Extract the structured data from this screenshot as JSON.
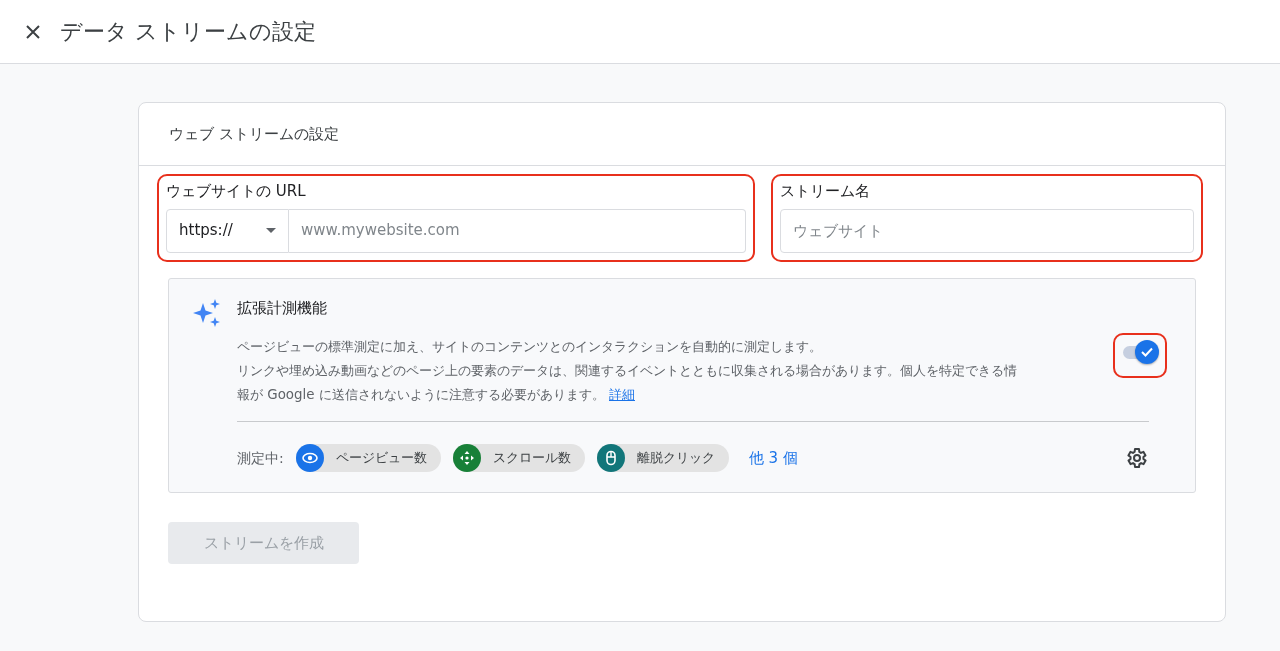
{
  "header": {
    "title": "データ ストリームの設定"
  },
  "card": {
    "title": "ウェブ ストリームの設定",
    "url_field": {
      "label": "ウェブサイトの URL",
      "protocol": "https://",
      "placeholder": "www.mywebsite.com",
      "highlighted": true
    },
    "name_field": {
      "label": "ストリーム名",
      "placeholder": "ウェブサイト",
      "highlighted": true
    },
    "enhanced": {
      "title": "拡張計測機能",
      "description": [
        "ページビューの標準測定に加え、サイトのコンテンツとのインタラクションを自動的に測定します。",
        "リンクや埋め込み動画などのページ上の要素のデータは、関連するイベントとともに収集される場合があります。個人を特定できる情報が Google に送信されないように注意する必要があります。"
      ],
      "link": "詳細",
      "toggle": {
        "on": true,
        "highlighted": true
      },
      "measuring_label": "測定中:",
      "chips": [
        {
          "label": "ページビュー数",
          "kind": "eye",
          "color": "#1a73e8"
        },
        {
          "label": "スクロール数",
          "kind": "scroll",
          "color": "#188038"
        },
        {
          "label": "離脱クリック",
          "kind": "mouse",
          "color": "#12767a"
        }
      ],
      "more": "他 3 個"
    },
    "create_button": {
      "label": "ストリームを作成",
      "disabled": true
    }
  }
}
